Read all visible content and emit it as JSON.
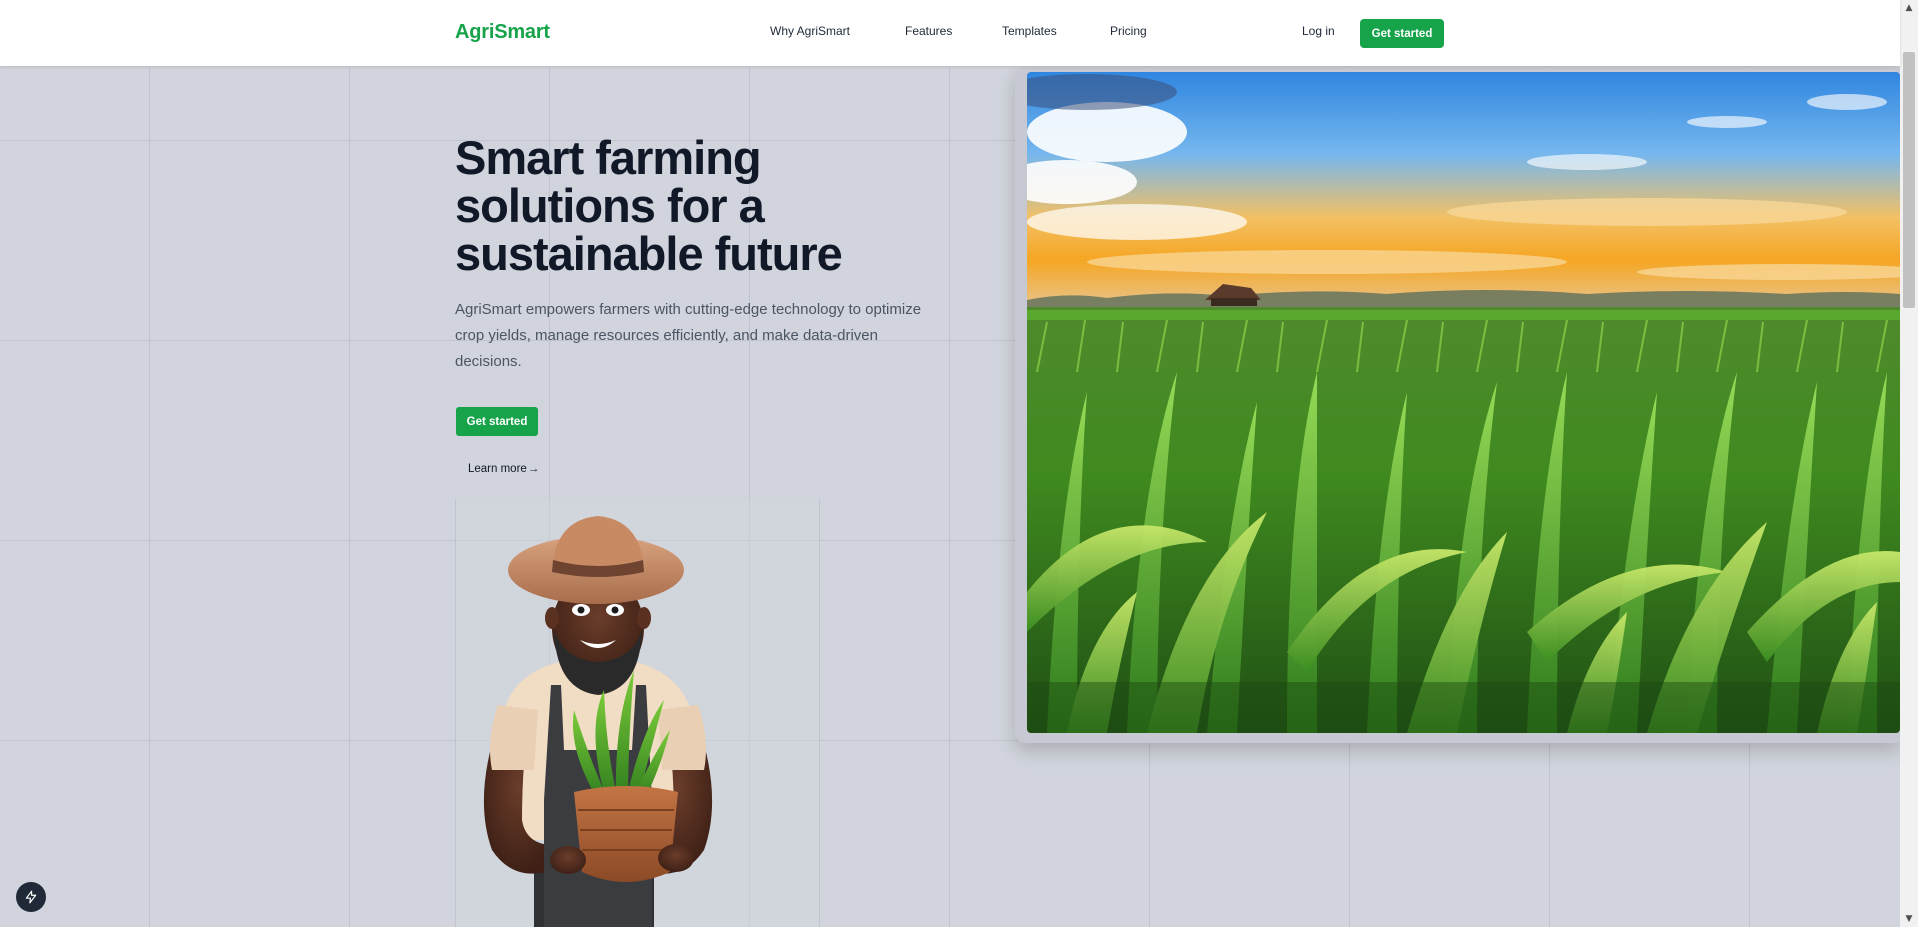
{
  "brand": {
    "name": "AgriSmart",
    "accent_color": "#16a34a"
  },
  "nav": {
    "links": [
      {
        "label": "Why AgriSmart",
        "id": "why-agrismart"
      },
      {
        "label": "Features",
        "id": "features"
      },
      {
        "label": "Templates",
        "id": "templates"
      },
      {
        "label": "Pricing",
        "id": "pricing"
      }
    ],
    "login_label": "Log in",
    "cta_label": "Get started"
  },
  "hero": {
    "title": "Smart farming solutions for a sustainable future",
    "subtitle": "AgriSmart empowers farmers with cutting-edge technology to optimize crop yields, manage resources efficiently, and make data-driven decisions.",
    "cta_label": "Get started",
    "learn_more_label": "Learn more",
    "learn_more_arrow": "→"
  },
  "images": {
    "hero_image": "cornfield-sunset-image",
    "farmer_illustration": "farmer-with-basket-illustration"
  },
  "fab": {
    "icon": "lightning-bolt-icon"
  },
  "scrollbar": {
    "up_glyph": "▲",
    "down_glyph": "▼"
  }
}
